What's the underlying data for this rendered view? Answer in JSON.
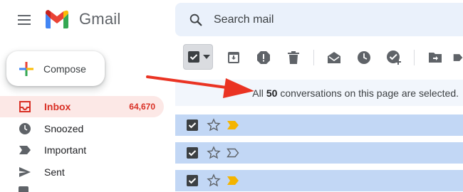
{
  "header": {
    "brand": "Gmail",
    "search_placeholder": "Search mail"
  },
  "compose": {
    "label": "Compose"
  },
  "sidebar": {
    "items": [
      {
        "label": "Inbox",
        "count": "64,670",
        "active": true,
        "icon": "inbox-icon"
      },
      {
        "label": "Snoozed",
        "icon": "clock-icon"
      },
      {
        "label": "Important",
        "icon": "label-important-icon"
      },
      {
        "label": "Sent",
        "icon": "send-icon"
      }
    ]
  },
  "toolbar": {
    "icons": [
      "select-all-checkbox",
      "archive-icon",
      "report-spam-icon",
      "delete-icon",
      "mark-as-read-icon",
      "snooze-icon",
      "add-to-tasks-icon",
      "move-to-icon"
    ]
  },
  "banner": {
    "prefix": "All",
    "count": "50",
    "suffix": "conversations on this page are selected."
  },
  "rows": [
    {
      "selected": true,
      "important": true
    },
    {
      "selected": true,
      "important": false
    },
    {
      "selected": true,
      "important": true
    }
  ],
  "colors": {
    "accent_red": "#d93025",
    "inbox_bg": "#fce8e6",
    "selected_row": "#c2d7f5",
    "annotation_arrow": "#ea3323",
    "important_marker": "#f4b400"
  }
}
